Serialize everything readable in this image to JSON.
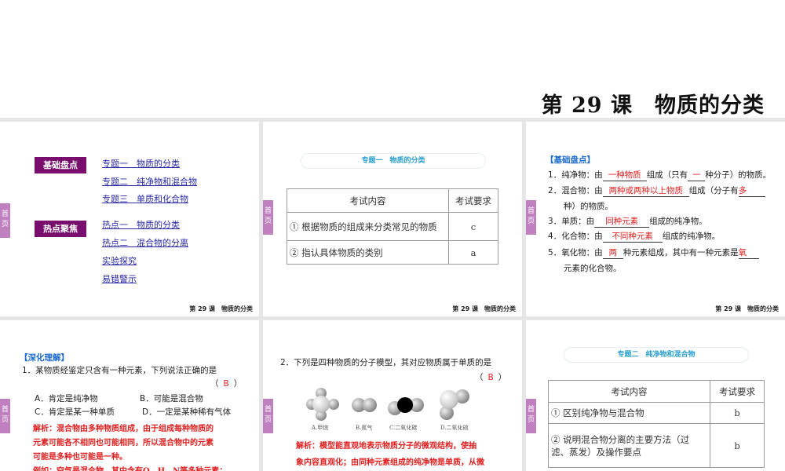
{
  "header": {
    "title": "第 29 课　物质的分类"
  },
  "common": {
    "home_label": "首页",
    "footer": "第 29 课　物质的分类"
  },
  "slide1": {
    "tags": [
      "基础盘点",
      "热点聚焦"
    ],
    "links": [
      "专题一　物质的分类",
      "专题二　纯净物和混合物",
      "专题三　单质和化合物",
      "热点一　物质的分类",
      "热点二　混合物的分离",
      "实验探究",
      "易错警示"
    ]
  },
  "slide2": {
    "heading": "专题一　物质的分类",
    "table": {
      "headers": [
        "考试内容",
        "考试要求"
      ],
      "rows": [
        [
          "① 根据物质的组成来分类常见的物质",
          "c"
        ],
        [
          "② 指认具体物质的类别",
          "a"
        ]
      ]
    }
  },
  "slide3": {
    "heading": "【基础盘点】",
    "items": [
      {
        "num": "1．",
        "pre": "纯净物：由",
        "ans": "一种物质",
        "mid": "组成（只有",
        "ans2": "一",
        "post": "种分子）的物质。"
      },
      {
        "num": "2．",
        "pre": "混合物：由",
        "ans": "两种或两种以上物质",
        "mid": "组成（分子有",
        "ans2": "多",
        "post": "",
        "cont": "种）的物质。"
      },
      {
        "num": "3．",
        "pre": "单质：由",
        "ans": "同种元素",
        "mid": "组成的纯净物。"
      },
      {
        "num": "4．",
        "pre": "化合物：由",
        "ans": "不同种元素",
        "mid": "组成的纯净物。"
      },
      {
        "num": "5．",
        "pre": "氧化物：由",
        "ans": "两",
        "mid": "种元素组成，其中有一种元素是",
        "ans2": "氧",
        "post": "",
        "cont": "元素的化合物。"
      }
    ]
  },
  "slide4": {
    "heading": "【深化理解】",
    "question": "1．某物质经鉴定只含有一种元素，下列说法正确的是",
    "answer_open": "（",
    "answer": "B",
    "answer_close": "）",
    "options": [
      "A．肯定是纯净物",
      "B．可能是混合物",
      "C．肯定是某一种单质",
      "D．一定是某种稀有气体"
    ],
    "explanation": [
      "解析：混合物由多种物质组成，由于组成每种物质的",
      "元素可能各不相同也可能相同，所以混合物中的元素",
      "可能是多种也可能是一种。",
      "例如：空气是混合物，其中含有O、H、N等多种元素；"
    ]
  },
  "slide5": {
    "question": "2．下列是四种物质的分子模型，其对应物质属于单质的是",
    "answer_open": "（",
    "answer": "B",
    "answer_close": "）",
    "captions": [
      "A.甲烷",
      "B.氮气",
      "C.二氧化碳",
      "D.二氧化硫"
    ],
    "explanation": [
      "解析：模型能直观地表示物质分子的微观结构，使抽",
      "象内容直观化；由同种元素组成的纯净物是单质，从微"
    ]
  },
  "slide6": {
    "heading": "专题二　纯净物和混合物",
    "table": {
      "headers": [
        "考试内容",
        "考试要求"
      ],
      "rows": [
        [
          "① 区别纯净物与混合物",
          "b"
        ],
        [
          "② 说明混合物分离的主要方法（过滤、蒸发）及操作要点",
          "b"
        ]
      ]
    }
  }
}
